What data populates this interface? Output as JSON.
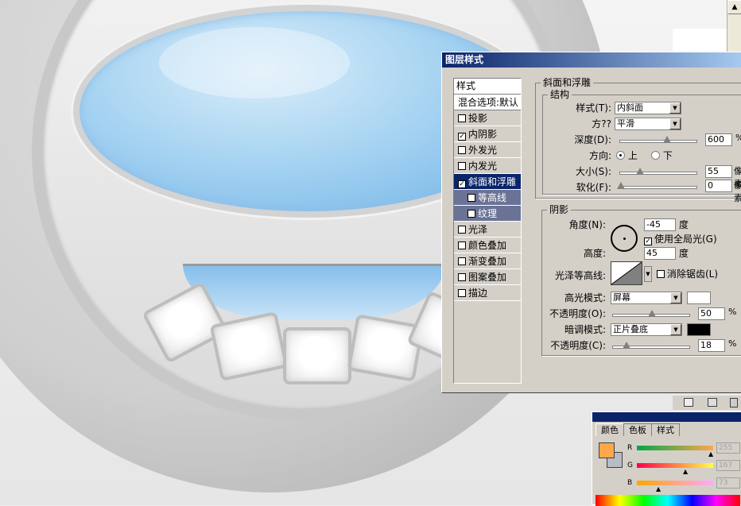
{
  "colors": {
    "title_start": "#0a246a",
    "title_end": "#a6caf0",
    "lens_blue": "#6eb2e6",
    "panel_bg": "#d4d0c8",
    "foreground": "#ffa749",
    "background": "#b8bcc4"
  },
  "dialog": {
    "title": "图层样式",
    "styles_header": "样式",
    "blend_options": "混合选项:默认",
    "styles": [
      {
        "label": "投影",
        "checked": false
      },
      {
        "label": "内阴影",
        "checked": true
      },
      {
        "label": "外发光",
        "checked": false
      },
      {
        "label": "内发光",
        "checked": false
      },
      {
        "label": "斜面和浮雕",
        "checked": true,
        "selected": true
      },
      {
        "label": "等高线",
        "checked": false,
        "sub": true
      },
      {
        "label": "纹理",
        "checked": false,
        "sub": true
      },
      {
        "label": "光泽",
        "checked": false
      },
      {
        "label": "颜色叠加",
        "checked": false
      },
      {
        "label": "渐变叠加",
        "checked": false
      },
      {
        "label": "图案叠加",
        "checked": false
      },
      {
        "label": "描边",
        "checked": false
      }
    ],
    "bevel": {
      "group_title": "斜面和浮雕",
      "structure_title": "结构",
      "style_label": "样式(T):",
      "style_value": "内斜面",
      "technique_label": "方??",
      "technique_value": "平滑",
      "depth_label": "深度(D):",
      "depth_value": "600",
      "depth_unit": "%",
      "direction_label": "方向:",
      "direction_up": "上",
      "direction_down": "下",
      "size_label": "大小(S):",
      "size_value": "55",
      "size_unit": "像素",
      "soften_label": "软化(F):",
      "soften_value": "0",
      "soften_unit": "像素"
    },
    "shading": {
      "title": "阴影",
      "angle_label": "角度(N):",
      "angle_value": "-45",
      "angle_unit": "度",
      "global_light_label": "使用全局光(G)",
      "altitude_label": "高度:",
      "altitude_value": "45",
      "altitude_unit": "度",
      "gloss_label": "光泽等高线:",
      "antialias_label": "消除锯齿(L)",
      "highlight_mode_label": "高光模式:",
      "highlight_mode_value": "屏幕",
      "highlight_opacity_label": "不透明度(O):",
      "highlight_opacity_value": "50",
      "shadow_mode_label": "暗调模式:",
      "shadow_mode_value": "正片叠底",
      "shadow_opacity_label": "不透明度(C):",
      "shadow_opacity_value": "18",
      "percent": "%"
    }
  },
  "color_panel": {
    "tabs": [
      "颜色",
      "色板",
      "样式"
    ],
    "channels": [
      {
        "label": "R",
        "value": "255"
      },
      {
        "label": "G",
        "value": "167"
      },
      {
        "label": "B",
        "value": "73"
      }
    ]
  }
}
